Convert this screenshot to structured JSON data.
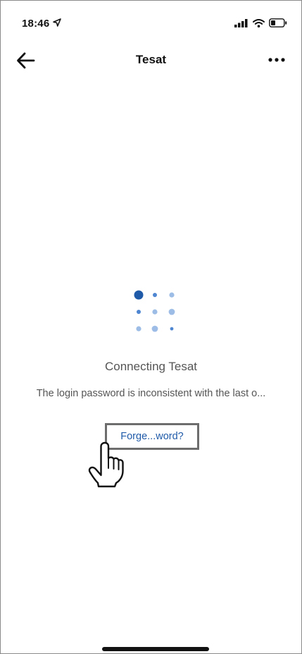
{
  "status_bar": {
    "time": "18:46",
    "icons": [
      "location-arrow-icon",
      "signal-icon",
      "wifi-icon",
      "battery-icon"
    ]
  },
  "nav_bar": {
    "title": "Tesat",
    "back_icon": "back-arrow-icon",
    "more_icon": "more-dots-icon"
  },
  "main": {
    "loader_icon": "loading-dots-icon",
    "connecting_text": "Connecting Tesat",
    "message": "The login password is inconsistent with the last o...",
    "forgot_link": "Forge...word?"
  },
  "overlay": {
    "pointer_icon": "hand-pointer-icon"
  },
  "colors": {
    "link": "#1f5aa8",
    "loader_dark": "#1f5aa8",
    "loader_mid": "#4f86d1",
    "loader_light": "#9dbde6",
    "text_muted": "#555555"
  }
}
